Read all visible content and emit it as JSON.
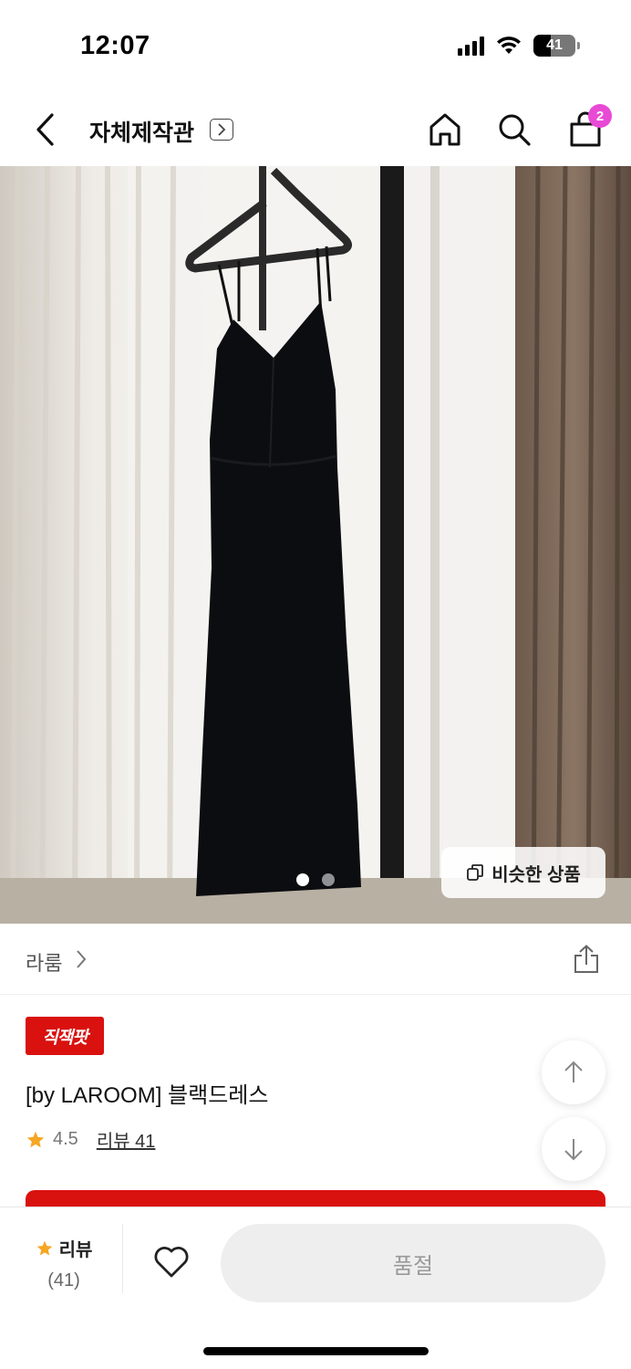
{
  "status_bar": {
    "time": "12:07",
    "battery": "41",
    "battery_level": 0.41
  },
  "nav": {
    "title": "자체제작관",
    "cart_badge": "2"
  },
  "hero": {
    "similar_label": "비슷한 상품",
    "page_count": 2,
    "current_page": 1
  },
  "brand": {
    "name": "라룸"
  },
  "product": {
    "tag": "직잭팟",
    "name": "[by LAROOM] 블랙드레스",
    "rating": "4.5",
    "review_link": "리뷰 41"
  },
  "bottom_bar": {
    "review_label": "리뷰",
    "review_count": "(41)",
    "soldout_label": "품절"
  },
  "colors": {
    "accent_red": "#d9110f",
    "badge_pink": "#e84ad6",
    "star": "#f6a623"
  }
}
